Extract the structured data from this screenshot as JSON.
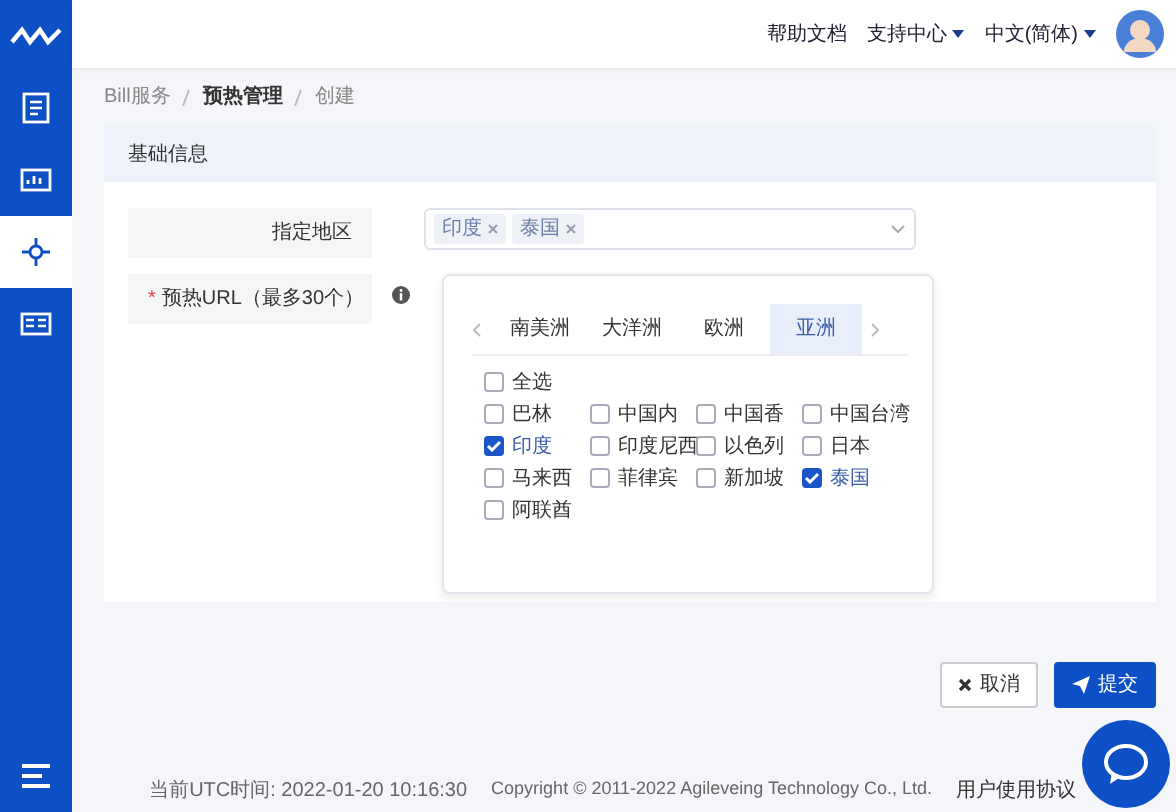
{
  "sidebar": {
    "items": [
      {
        "selected": false
      },
      {
        "selected": false
      },
      {
        "selected": true
      },
      {
        "selected": false
      }
    ]
  },
  "header": {
    "links": [
      {
        "label": "帮助文档",
        "dropdown": false
      },
      {
        "label": "支持中心",
        "dropdown": true
      },
      {
        "label": "中文(简体)",
        "dropdown": true
      }
    ]
  },
  "breadcrumb": [
    "Bill服务",
    "预热管理",
    "创建"
  ],
  "section": {
    "title": "基础信息"
  },
  "form": {
    "region": {
      "label": "指定地区",
      "tags": [
        "印度",
        "泰国"
      ]
    },
    "url": {
      "label": "预热URL（最多30个）",
      "required_mark": "*"
    }
  },
  "dropdown": {
    "tabs": [
      {
        "label": "南美洲",
        "selected": false
      },
      {
        "label": "大洋洲",
        "selected": false
      },
      {
        "label": "欧洲",
        "selected": false
      },
      {
        "label": "亚洲",
        "selected": true
      }
    ],
    "select_all": {
      "label": "全选",
      "checked": false
    },
    "options": [
      {
        "label": "巴林",
        "checked": false
      },
      {
        "label": "中国内",
        "checked": false
      },
      {
        "label": "中国香",
        "checked": false
      },
      {
        "label": "中国台湾",
        "checked": false
      },
      {
        "label": "印度",
        "checked": true
      },
      {
        "label": "印度尼西",
        "checked": false
      },
      {
        "label": "以色列",
        "checked": false
      },
      {
        "label": "日本",
        "checked": false
      },
      {
        "label": "马来西",
        "checked": false
      },
      {
        "label": "菲律宾",
        "checked": false
      },
      {
        "label": "新加坡",
        "checked": false
      },
      {
        "label": "泰国",
        "checked": true
      },
      {
        "label": "阿联酋",
        "checked": false
      }
    ]
  },
  "buttons": [
    {
      "label": "取消",
      "kind": "cancel"
    },
    {
      "label": "提交",
      "kind": "submit"
    }
  ],
  "footer": {
    "time": "当前UTC时间: 2022-01-20 10:16:30",
    "copyright": "Copyright © 2011-2022 Agileveing Technology Co., Ltd.",
    "link": "用户使用协议"
  }
}
